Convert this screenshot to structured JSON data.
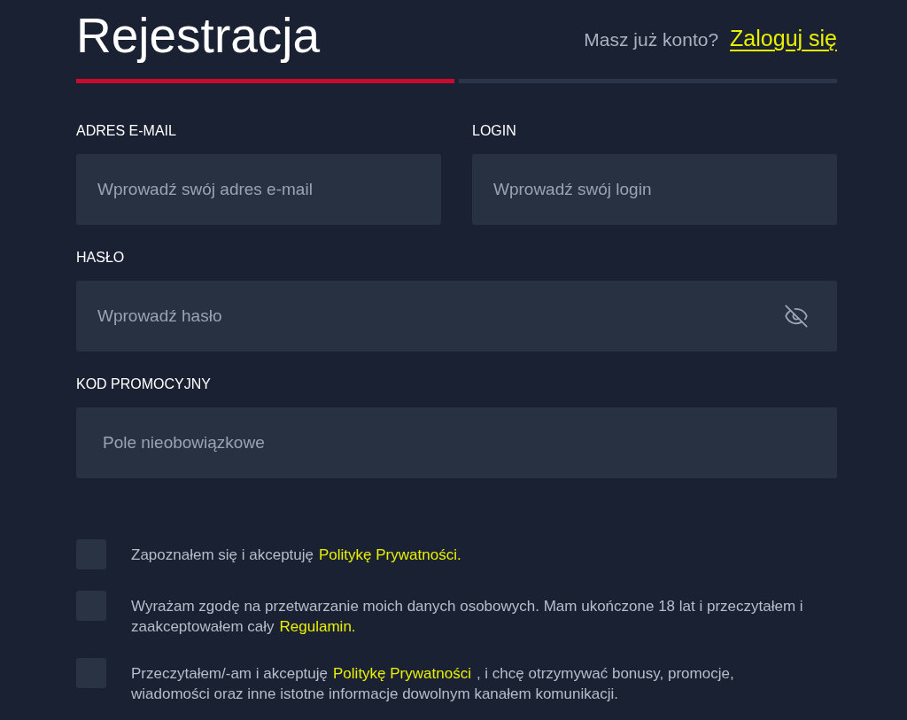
{
  "header": {
    "title": "Rejestracja",
    "prompt": "Masz już konto?",
    "login_link": "Zaloguj się"
  },
  "steps": [
    {
      "active": true
    },
    {
      "active": false
    }
  ],
  "field_rows": [
    {
      "fields": [
        {
          "label": "ADRES E-MAIL",
          "placeholder": "Wprowadź swój adres e-mail",
          "kind": "text"
        },
        {
          "label": "LOGIN",
          "placeholder": "Wprowadź swój login",
          "kind": "text"
        }
      ]
    },
    {
      "fields": [
        {
          "label": "HASŁO",
          "placeholder": "Wprowadź hasło",
          "kind": "password"
        }
      ]
    },
    {
      "fields": [
        {
          "label": "KOD PROMOCYJNY",
          "placeholder": "Pole nieobowiązkowe",
          "kind": "optional"
        }
      ]
    }
  ],
  "consents": [
    {
      "checked": false,
      "parts": [
        {
          "kind": "text",
          "text": "Zapoznałem się i akceptuję"
        },
        {
          "kind": "link",
          "text": "Politykę Prywatności."
        }
      ]
    },
    {
      "checked": false,
      "parts": [
        {
          "kind": "text",
          "text": "Wyrażam zgodę na przetwarzanie moich danych osobowych. Mam ukończone 18 lat i przeczytałem i zaakceptowałem cały"
        },
        {
          "kind": "link",
          "text": "Regulamin."
        }
      ]
    },
    {
      "checked": false,
      "parts": [
        {
          "kind": "text",
          "text": "Przeczytałem/-am i akceptuję"
        },
        {
          "kind": "link",
          "text": "Politykę Prywatności"
        },
        {
          "kind": "text",
          "text": ", i chcę otrzymywać bonusy, promocje, wiadomości oraz inne istotne informacje dowolnym kanałem komunikacji."
        }
      ]
    }
  ]
}
